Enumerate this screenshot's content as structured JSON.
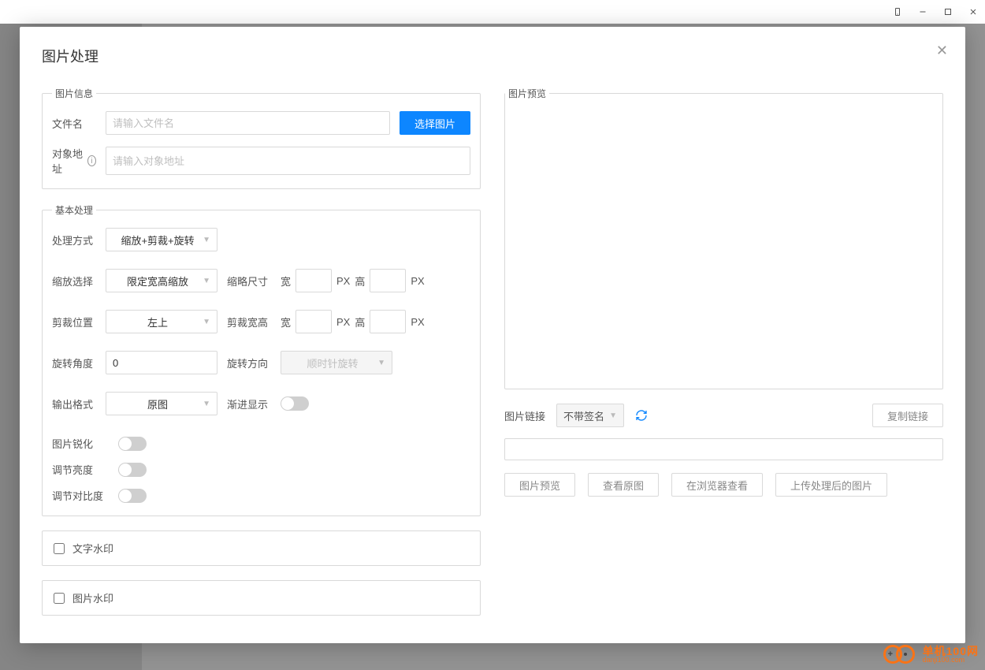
{
  "modal": {
    "title": "图片处理"
  },
  "imageInfo": {
    "legend": "图片信息",
    "filename_label": "文件名",
    "filename_placeholder": "请输入文件名",
    "select_btn": "选择图片",
    "objaddr_label": "对象地址",
    "objaddr_placeholder": "请输入对象地址"
  },
  "basic": {
    "legend": "基本处理",
    "mode_label": "处理方式",
    "mode_value": "缩放+剪裁+旋转",
    "scale_label": "缩放选择",
    "scale_value": "限定宽高缩放",
    "thumb_label": "缩略尺寸",
    "w_label": "宽",
    "h_label": "高",
    "px": "PX",
    "crop_label": "剪裁位置",
    "crop_value": "左上",
    "cropwh_label": "剪裁宽高",
    "rotate_label": "旋转角度",
    "rotate_value": "0",
    "rotdir_label": "旋转方向",
    "rotdir_value": "顺时针旋转",
    "fmt_label": "输出格式",
    "fmt_value": "原图",
    "prog_label": "渐进显示",
    "sharpen_label": "图片锐化",
    "bright_label": "调节亮度",
    "contrast_label": "调节对比度"
  },
  "watermark": {
    "text_label": "文字水印",
    "image_label": "图片水印"
  },
  "preview": {
    "legend": "图片预览",
    "link_label": "图片链接",
    "sign_value": "不带签名",
    "copy_btn": "复制链接",
    "act_preview": "图片预览",
    "act_orig": "查看原图",
    "act_browser": "在浏览器查看",
    "act_upload": "上传处理后的图片"
  },
  "branding": {
    "name": "单机100网",
    "domain": "danji100.com"
  }
}
